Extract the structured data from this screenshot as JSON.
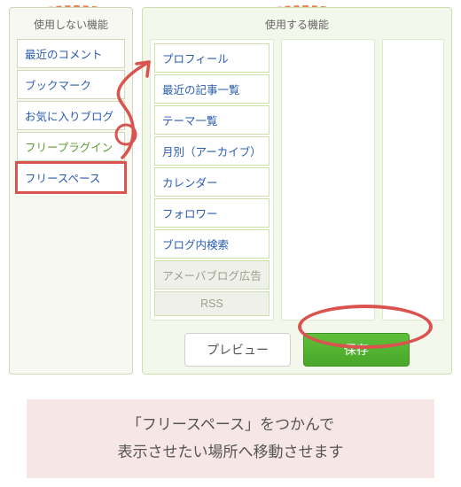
{
  "headers": {
    "unused": "使用しない機能",
    "used": "使用する機能"
  },
  "unused_items": [
    {
      "label": "最近のコメント",
      "muted": false,
      "selected": false,
      "red": false
    },
    {
      "label": "ブックマーク",
      "muted": false,
      "selected": false,
      "red": false
    },
    {
      "label": "お気に入りブログ",
      "muted": false,
      "selected": false,
      "red": false
    },
    {
      "label": "フリープラグイン",
      "muted": false,
      "selected": true,
      "red": false
    },
    {
      "label": "フリースペース",
      "muted": false,
      "selected": false,
      "red": true
    }
  ],
  "used_items": [
    {
      "label": "プロフィール",
      "muted": false
    },
    {
      "label": "最近の記事一覧",
      "muted": false
    },
    {
      "label": "テーマ一覧",
      "muted": false
    },
    {
      "label": "月別（アーカイブ）",
      "muted": false
    },
    {
      "label": "カレンダー",
      "muted": false
    },
    {
      "label": "フォロワー",
      "muted": false
    },
    {
      "label": "ブログ内検索",
      "muted": false
    },
    {
      "label": "アメーバブログ広告",
      "muted": true
    },
    {
      "label": "RSS",
      "muted": true
    }
  ],
  "buttons": {
    "preview": "プレビュー",
    "save": "保存"
  },
  "caption_line1": "「フリースペース」をつかんで",
  "caption_line2": "表示させたい場所へ移動させます",
  "colors": {
    "accent_orange": "#ef7f52",
    "accent_red": "#d9534f",
    "accent_green": "#4aa72a",
    "link_blue": "#2a5db0"
  }
}
